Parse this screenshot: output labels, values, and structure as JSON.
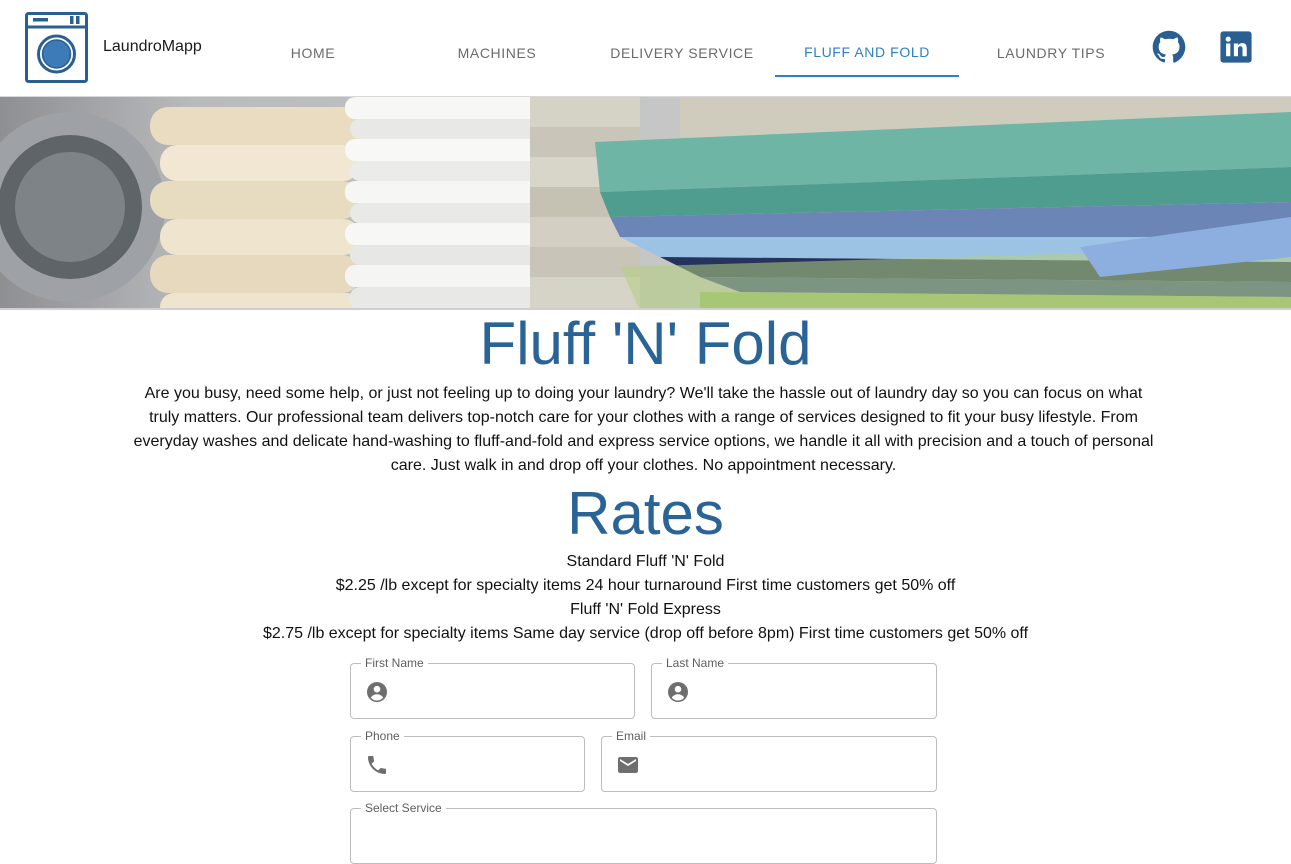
{
  "brand": {
    "name": "LaundroMapp"
  },
  "nav": {
    "tabs": [
      {
        "label": "HOME",
        "active": false
      },
      {
        "label": "MACHINES",
        "active": false
      },
      {
        "label": "DELIVERY SERVICE",
        "active": false
      },
      {
        "label": "FLUFF AND FOLD",
        "active": true
      },
      {
        "label": "LAUNDRY TIPS",
        "active": false
      }
    ],
    "social": [
      "github-icon",
      "linkedin-icon"
    ]
  },
  "hero": {
    "subject": "stacks of folded laundry"
  },
  "main": {
    "title": "Fluff 'N' Fold",
    "intro": "Are you busy, need some help, or just not feeling up to doing your laundry? We'll take the hassle out of laundry day so you can focus on what truly matters. Our professional team delivers top-notch care for your clothes with a range of services designed to fit your busy lifestyle. From everyday washes and delicate hand-washing to fluff-and-fold and express service options, we handle it all with precision and a touch of personal care. Just walk in and drop off your clothes. No appointment necessary.",
    "rates_title": "Rates",
    "rates": [
      {
        "name": "Standard Fluff 'N' Fold",
        "details": "$2.25 /lb except for specialty items 24 hour turnaround First time customers get 50% off"
      },
      {
        "name": "Fluff 'N' Fold Express",
        "details": "$2.75 /lb except for specialty items Same day service (drop off before 8pm) First time customers get 50% off"
      }
    ]
  },
  "form": {
    "first_name": {
      "label": "First Name",
      "icon": "account-circle-icon",
      "value": ""
    },
    "last_name": {
      "label": "Last Name",
      "icon": "account-circle-icon",
      "value": ""
    },
    "phone": {
      "label": "Phone",
      "icon": "phone-icon",
      "value": ""
    },
    "email": {
      "label": "Email",
      "icon": "email-icon",
      "value": ""
    },
    "service": {
      "label": "Select Service",
      "value": ""
    }
  },
  "colors": {
    "accent": "#2f7fc9",
    "heading": "#2a6496",
    "logo": "#2a5f93",
    "nav_text": "#6b6b6b"
  }
}
